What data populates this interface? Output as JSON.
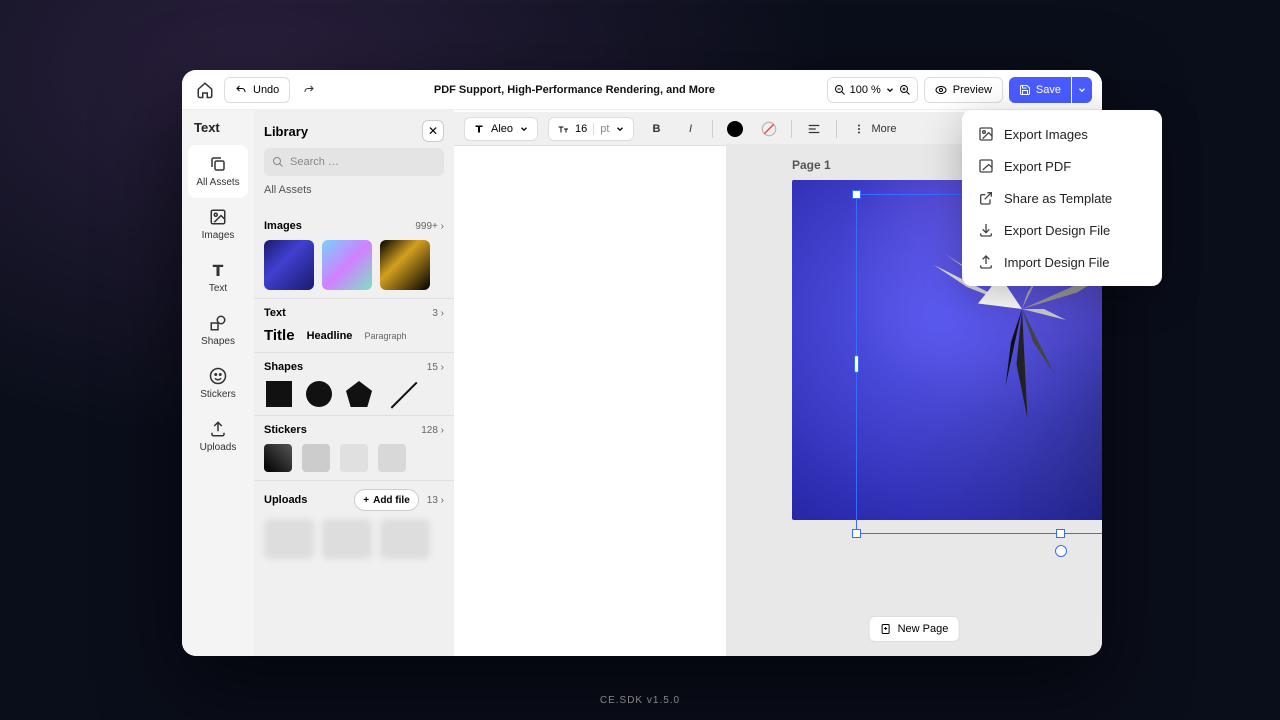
{
  "footer": "CE.SDK v1.5.0",
  "topbar": {
    "undo": "Undo",
    "title": "PDF Support, High-Performance Rendering, and More",
    "zoom": "100 %",
    "preview": "Preview",
    "save": "Save"
  },
  "context_toolbar": {
    "font": "Aleo",
    "size": "16",
    "size_unit": "pt",
    "more": "More"
  },
  "siderail": {
    "header": "Text",
    "items": [
      {
        "id": "all-assets",
        "label": "All Assets"
      },
      {
        "id": "images",
        "label": "Images"
      },
      {
        "id": "text",
        "label": "Text"
      },
      {
        "id": "shapes",
        "label": "Shapes"
      },
      {
        "id": "stickers",
        "label": "Stickers"
      },
      {
        "id": "uploads",
        "label": "Uploads"
      }
    ]
  },
  "library": {
    "title": "Library",
    "search_placeholder": "Search …",
    "all_assets": "All Assets",
    "sections": {
      "images": {
        "title": "Images",
        "count": "999+"
      },
      "text": {
        "title": "Text",
        "count": "3",
        "samples": {
          "title": "Title",
          "headline": "Headline",
          "paragraph": "Paragraph"
        }
      },
      "shapes": {
        "title": "Shapes",
        "count": "15"
      },
      "stickers": {
        "title": "Stickers",
        "count": "128"
      },
      "uploads": {
        "title": "Uploads",
        "count": "13",
        "addfile": "Add file"
      }
    }
  },
  "canvas": {
    "page_label": "Page 1",
    "new_page": "New Page"
  },
  "export_menu": {
    "items": [
      {
        "id": "export-images",
        "label": "Export Images"
      },
      {
        "id": "export-pdf",
        "label": "Export PDF"
      },
      {
        "id": "share-template",
        "label": "Share as Template"
      },
      {
        "id": "export-design",
        "label": "Export Design File"
      },
      {
        "id": "import-design",
        "label": "Import Design File"
      }
    ]
  }
}
